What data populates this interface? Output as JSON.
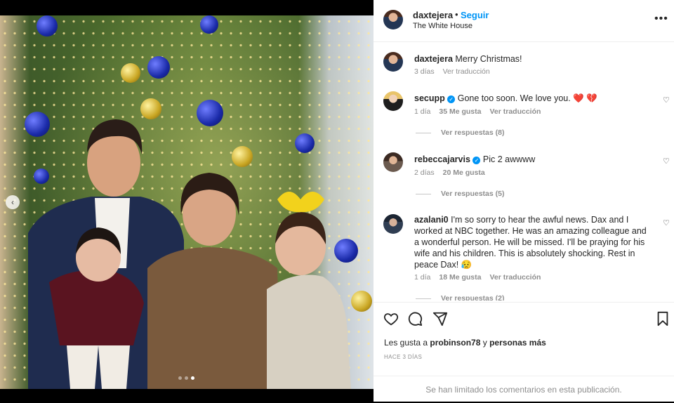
{
  "post": {
    "username": "daxtejera",
    "follow_label": "Seguir",
    "location": "The White House",
    "caption_user": "daxtejera",
    "caption_text": "Merry Christmas!",
    "caption_time": "3 días",
    "caption_translate": "Ver traducción"
  },
  "comments": [
    {
      "user": "secupp",
      "text": "Gone too soon. We love you. ❤️ 💔",
      "time": "1 día",
      "likes": "35 Me gusta",
      "translate": "Ver traducción",
      "replies": "Ver respuestas (8)"
    },
    {
      "user": "rebeccajarvis",
      "text": "Pic 2 awwww",
      "time": "2 días",
      "likes": "20 Me gusta",
      "replies": "Ver respuestas (5)"
    },
    {
      "user": "azalani0",
      "text": "I'm so sorry to hear the awful news. Dax and I worked at NBC together. He was an amazing colleague and a wonderful person. He will be missed. I'll be praying for his wife and his children. This is absolutely shocking. Rest in peace Dax! 😥",
      "time": "1 día",
      "likes": "18 Me gusta",
      "translate": "Ver traducción",
      "replies": "Ver respuestas (2)"
    }
  ],
  "likes": {
    "prefix": "Les gusta a",
    "user": "probinson78",
    "joiner": "y",
    "others": "personas más"
  },
  "date": "HACE 3 DÍAS",
  "comments_limited": "Se han limitado los comentarios en esta publicación.",
  "carousel": {
    "total": 3,
    "active": 3
  },
  "colors": {
    "accent": "#0095f6",
    "verified": "#0095f6",
    "heart": "#ed4956"
  }
}
